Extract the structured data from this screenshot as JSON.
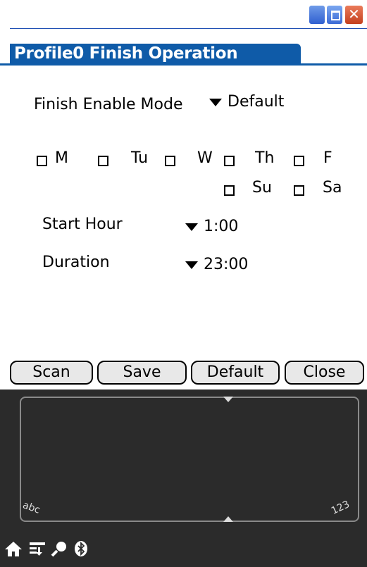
{
  "window": {
    "title": "Profile0 Finish Operation"
  },
  "finish_enable_mode": {
    "label": "Finish Enable Mode",
    "value": "Default"
  },
  "days": {
    "row1": [
      "M",
      "Tu",
      "W",
      "Th",
      "F"
    ],
    "row2": [
      "Su",
      "Sa"
    ]
  },
  "start_hour": {
    "label": "Start Hour",
    "value": "1:00"
  },
  "duration": {
    "label": "Duration",
    "value": "23:00"
  },
  "buttons": {
    "scan": "Scan",
    "save": "Save",
    "default": "Default",
    "close": "Close"
  },
  "graffiti": {
    "abc": "abc",
    "numbers": "123"
  },
  "icons": [
    "home-icon",
    "menu-icon",
    "find-icon",
    "bluetooth-icon",
    "minimize-icon",
    "maximize-icon",
    "close-icon"
  ]
}
